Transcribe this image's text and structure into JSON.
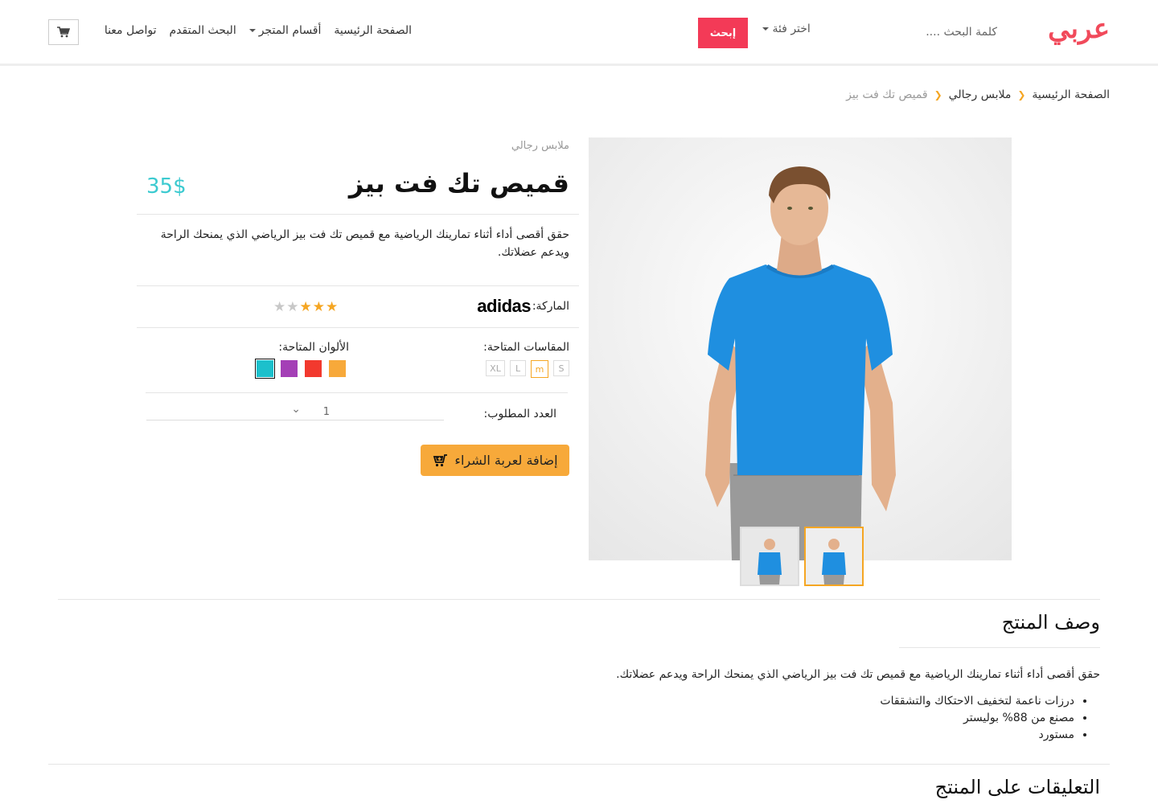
{
  "header": {
    "logo": "عربي",
    "search_placeholder": "كلمة البحث ....",
    "category_select": "اختر فئة",
    "search_button": "إبحث",
    "nav": {
      "home": "الصفحة الرئيسية",
      "store_sections": "أقسام المتجر",
      "advanced_search": "البحث المتقدم",
      "contact": "تواصل معنا"
    }
  },
  "breadcrumb": {
    "home": "الصفحة الرئيسية",
    "category": "ملابس رجالي",
    "current": "قميص تك فت بيز"
  },
  "product": {
    "category": "ملابس رجالي",
    "title": "قميص تك فت بيز",
    "price": "35$",
    "description": "حقق أقصى أداء أثناء تمارينك الرياضية مع قميص تك فت بيز الرياضي الذي يمنحك الراحة ويدعم عضلاتك.",
    "brand_label": "الماركة:",
    "brand": "adidas",
    "rating": {
      "value": 3,
      "max": 5
    },
    "sizes_label": "المقاسات المتاحة:",
    "sizes": [
      "S",
      "m",
      "L",
      "XL"
    ],
    "selected_size": "m",
    "colors_label": "الألوان المتاحة:",
    "colors": [
      "#f7a93a",
      "#f2392e",
      "#a43fb6",
      "#1cc0cc"
    ],
    "selected_color": "#1cc0cc",
    "quantity_label": "العدد المطلوب:",
    "quantity": "1",
    "add_to_cart": "إضافة لعربة الشراء",
    "accent_color": "#f7a93a",
    "shirt_color": "#1f8fe0"
  },
  "description_section": {
    "title": "وصف المنتج",
    "text": "حقق أقصى أداء أثناء تمارينك الرياضية مع قميص تك فت بيز الرياضي الذي يمنحك الراحة ويدعم عضلاتك.",
    "features": [
      "درزات ناعمة لتخفيف الاحتكاك والتشققات",
      "مصنع من 88% بوليستر",
      "مستورد"
    ]
  },
  "comments_section": {
    "title": "التعليقات على المنتج"
  }
}
